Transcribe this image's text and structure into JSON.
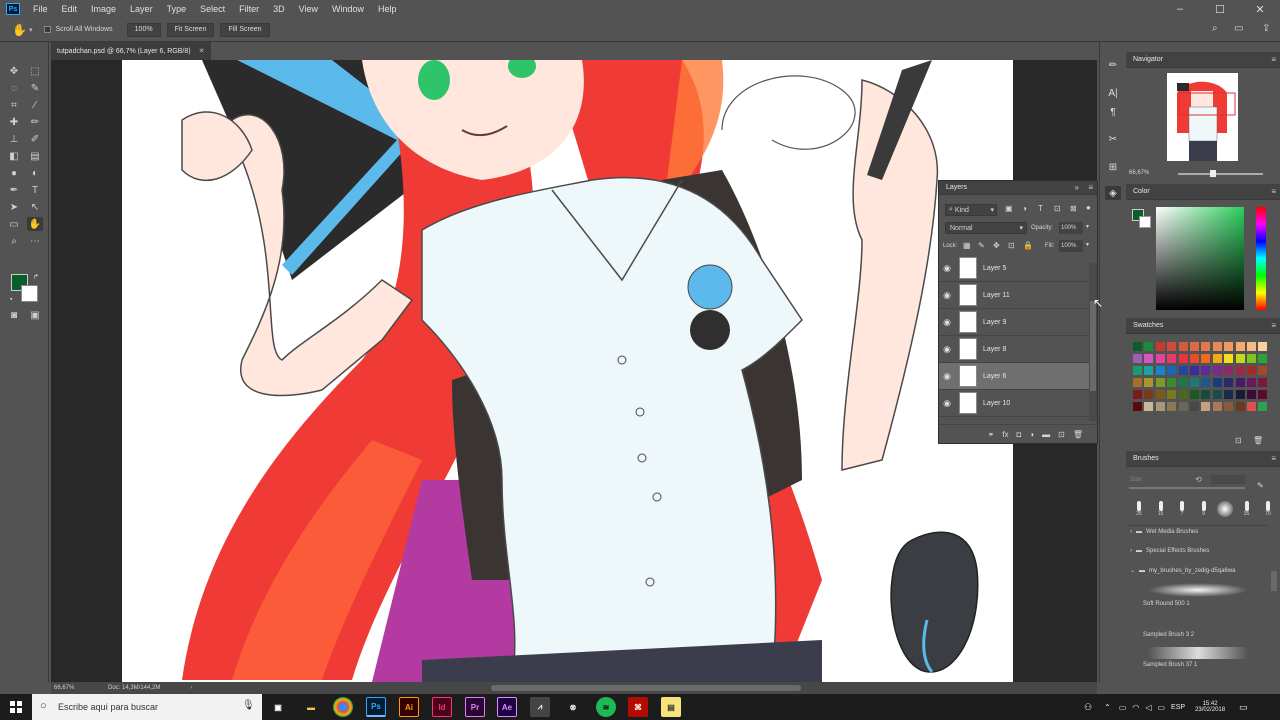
{
  "app": {
    "logo": "Ps"
  },
  "menu": [
    "File",
    "Edit",
    "Image",
    "Layer",
    "Type",
    "Select",
    "Filter",
    "3D",
    "View",
    "Window",
    "Help"
  ],
  "window_controls": [
    "minimize-icon",
    "maximize-icon",
    "close-icon"
  ],
  "options_bar": {
    "scroll_all_windows": "Scroll All Windows",
    "zoom_btn": "100%",
    "fit_btn": "Fit Screen",
    "fill_btn": "Fill Screen"
  },
  "document": {
    "tab_title": "tutpadchan.psd @ 66,7% (Layer 6, RGB/8)",
    "zoom": "66,67%",
    "doc_info": "Doc: 14,3M/144,2M"
  },
  "navigator": {
    "title": "Navigator",
    "zoom": "66,67%"
  },
  "color_panel": {
    "title": "Color",
    "foreground": "#0b5e2a",
    "background": "#ffffff"
  },
  "swatches": {
    "title": "Swatches",
    "colors": [
      "#0b5e2a",
      "#1a8b3b",
      "#c83b32",
      "#d24a3b",
      "#d65a40",
      "#dc6a47",
      "#e07a4c",
      "#e88a57",
      "#ef9a62",
      "#f5aa70",
      "#f8bb84",
      "#fcd09c",
      "#9b5fb6",
      "#d455c3",
      "#e045a0",
      "#e63a6a",
      "#e8343d",
      "#ea4b2a",
      "#f06a1e",
      "#f5a71a",
      "#f9dd1a",
      "#c5d81a",
      "#7fc31f",
      "#2ea236",
      "#1a9b6b",
      "#19a3a1",
      "#1984c8",
      "#1966b4",
      "#2346a0",
      "#3a2e98",
      "#5d2a98",
      "#7b2a8e",
      "#8e2a6a",
      "#9b2a4a",
      "#a12a2a",
      "#a2492a",
      "#a6702a",
      "#a8962a",
      "#7a9a2a",
      "#3a8a2a",
      "#1a7a4a",
      "#1a7a7a",
      "#1a5a8a",
      "#1a3a7a",
      "#2a2a6a",
      "#4a1a6a",
      "#6a1a5a",
      "#7a1a3a",
      "#7a1a1a",
      "#7a3a1a",
      "#7a5a1a",
      "#7a7a1a",
      "#4a6a1a",
      "#1a5a1a",
      "#1a4a3a",
      "#1a4a4a",
      "#1a2a4a",
      "#1a1a3a",
      "#3a0a3a",
      "#5a0a2a",
      "#5a0a0a",
      "#c8b89a",
      "#a89878",
      "#887858",
      "#686858",
      "#484848",
      "#c8a080",
      "#a87858",
      "#8a5a3a",
      "#6a3a1a",
      "#e05050",
      "#30a050"
    ]
  },
  "layers": {
    "title": "Layers",
    "kind_filter": "Kind",
    "blend_mode": "Normal",
    "opacity_label": "Opacity:",
    "opacity_value": "100%",
    "lock_label": "Lock:",
    "fill_label": "Fill:",
    "fill_value": "100%",
    "items": [
      {
        "name": "Layer 5",
        "selected": false
      },
      {
        "name": "Layer 11",
        "selected": false
      },
      {
        "name": "Layer 9",
        "selected": false
      },
      {
        "name": "Layer 8",
        "selected": false
      },
      {
        "name": "Layer 6",
        "selected": true
      },
      {
        "name": "Layer 10",
        "selected": false
      }
    ]
  },
  "brushes": {
    "title": "Brushes",
    "size_label": "Size:",
    "preset_sizes": [
      "25",
      "15",
      "7",
      "9",
      "",
      "35",
      "70"
    ],
    "groups": [
      "Wet Media Brushes",
      "Special Effects Brushes",
      "my_brushes_by_zedig-d5qa6wa"
    ],
    "items": [
      "Soft Round 500 1",
      "Sampled Brush 3 2",
      "Sampled Brush 37 1"
    ]
  },
  "taskbar": {
    "search_placeholder": "Escribe aquí para buscar",
    "apps": [
      "Ai",
      "Id",
      "Pr",
      "Ae"
    ],
    "language": "ESP",
    "time": "15:42",
    "date": "23/02/2018"
  }
}
